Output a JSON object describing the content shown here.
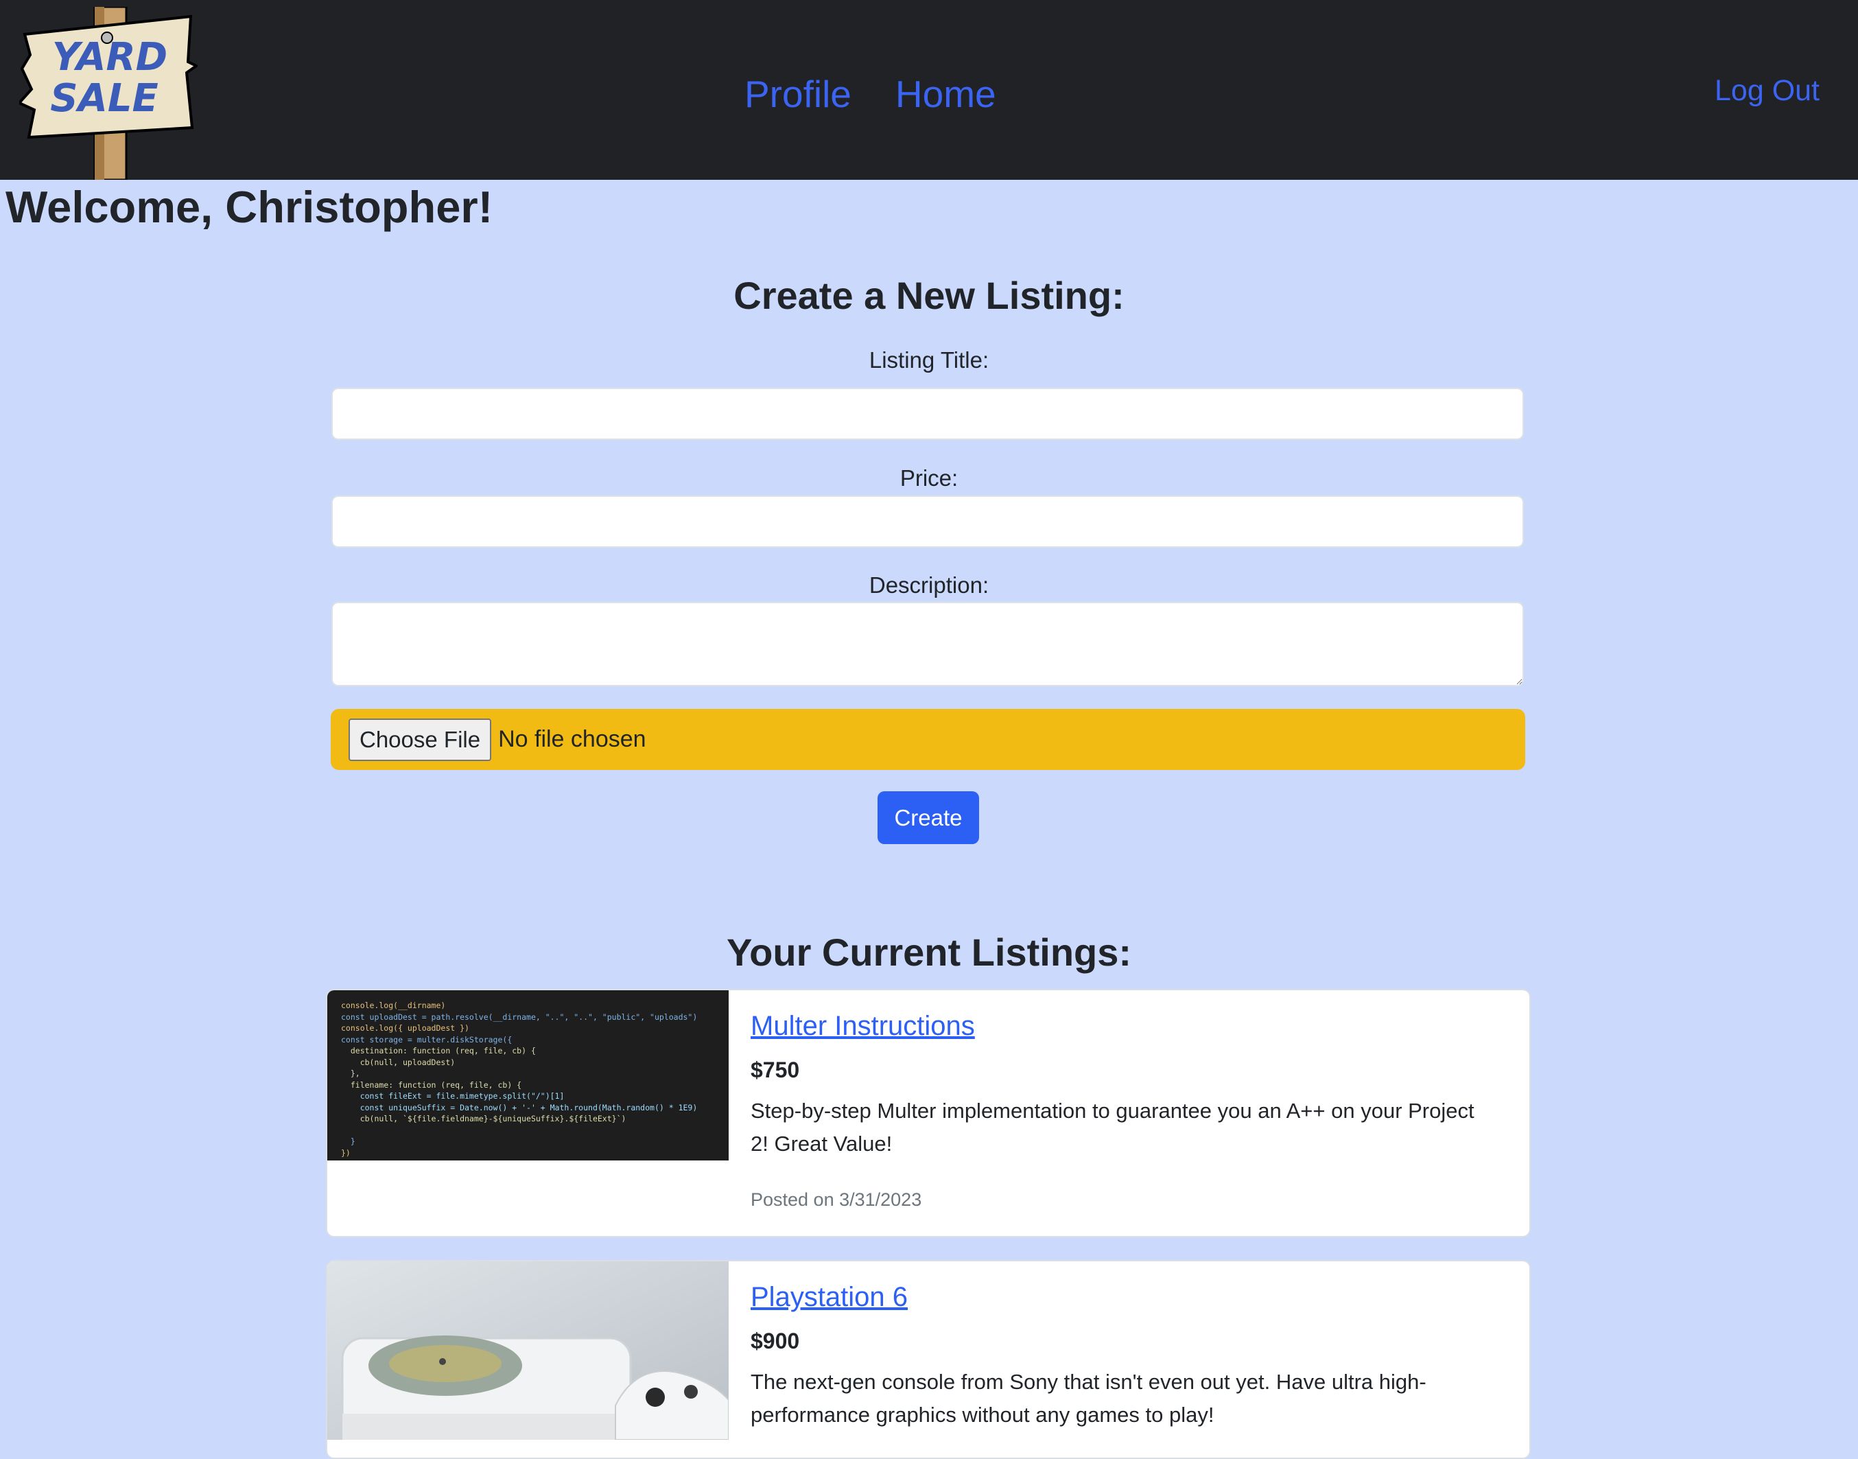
{
  "logo": {
    "line1": "YARD",
    "line2": "SALE"
  },
  "nav": {
    "profile": "Profile",
    "home": "Home",
    "logout": "Log Out"
  },
  "welcome": "Welcome, Christopher!",
  "form": {
    "title": "Create a New Listing:",
    "listing_title_label": "Listing Title:",
    "listing_title_value": "",
    "price_label": "Price:",
    "price_value": "",
    "description_label": "Description:",
    "description_value": "",
    "choose_file": "Choose File",
    "file_status": "No file chosen",
    "create": "Create"
  },
  "listings": {
    "title": "Your Current Listings:",
    "items": [
      {
        "title": "Multer Instructions",
        "price": "$750",
        "description": "Step-by-step Multer implementation to guarantee you an A++ on your Project 2! Great Value!",
        "date": "Posted on 3/31/2023",
        "thumb_code": [
          "console.log(__dirname)",
          "const uploadDest = path.resolve(__dirname, \"..\", \"..\", \"public\", \"uploads\")",
          "console.log({ uploadDest })",
          "const storage = multer.diskStorage({",
          "  destination: function (req, file, cb) {",
          "    cb(null, uploadDest)",
          "  },",
          "  filename: function (req, file, cb) {",
          "    const fileExt = file.mimetype.split(\"/\")[1]",
          "    const uniqueSuffix = Date.now() + '-' + Math.round(Math.random() * 1E9)",
          "    cb(null, `${file.fieldname}-${uniqueSuffix}.${fileExt}`)",
          "",
          "  }",
          "})"
        ]
      },
      {
        "title": "Playstation 6",
        "price": "$900",
        "description": "The next-gen console from Sony that isn't even out yet. Have ultra high-performance graphics without any games to play!",
        "date": ""
      }
    ]
  },
  "colors": {
    "nav_bg": "#212226",
    "page_bg": "#cbdafc",
    "link": "#3c64f2",
    "file_bar": "#f2bb13",
    "button": "#2c5ff4"
  }
}
